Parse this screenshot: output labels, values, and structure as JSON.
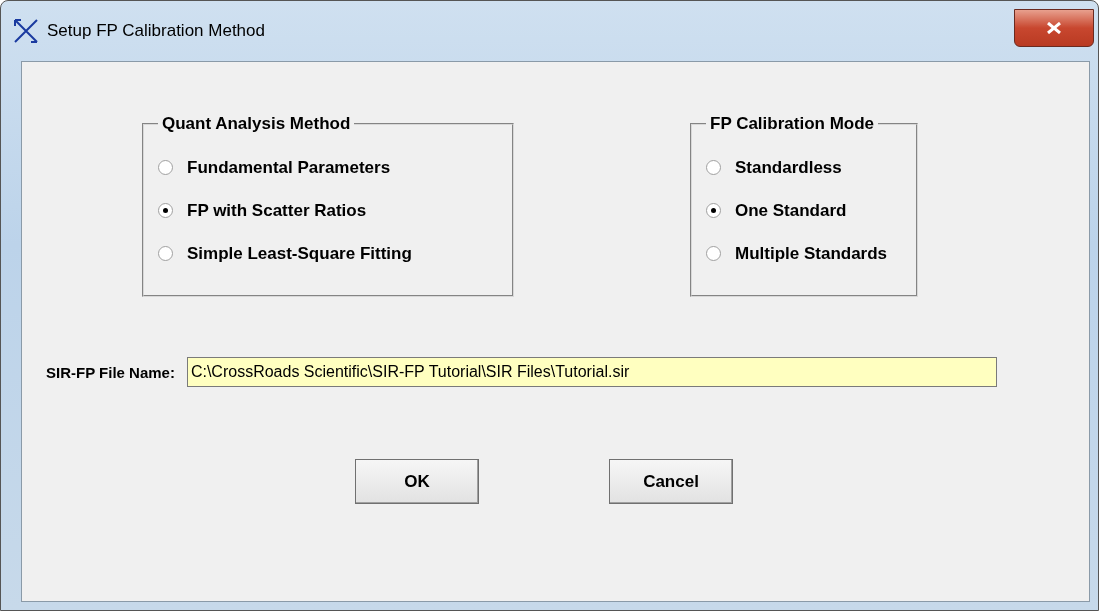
{
  "window": {
    "title": "Setup FP Calibration Method"
  },
  "groups": [
    {
      "title": "Quant Analysis Method",
      "options": [
        {
          "label": "Fundamental Parameters",
          "selected": false
        },
        {
          "label": "FP with Scatter Ratios",
          "selected": true
        },
        {
          "label": "Simple Least-Square Fitting",
          "selected": false
        }
      ]
    },
    {
      "title": "FP Calibration Mode",
      "options": [
        {
          "label": "Standardless",
          "selected": false
        },
        {
          "label": "One Standard",
          "selected": true
        },
        {
          "label": "Multiple Standards",
          "selected": false
        }
      ]
    }
  ],
  "file": {
    "label": "SIR-FP File Name:",
    "value": "C:\\CrossRoads Scientific\\SIR-FP Tutorial\\SIR Files\\Tutorial.sir"
  },
  "buttons": [
    "OK",
    "Cancel"
  ]
}
